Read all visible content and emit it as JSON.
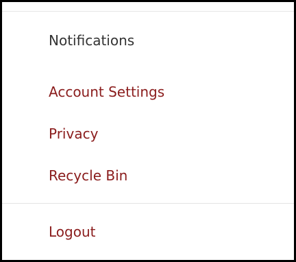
{
  "menu": {
    "header_label": "Notifications",
    "items": [
      {
        "label": "Account Settings"
      },
      {
        "label": "Privacy"
      },
      {
        "label": "Recycle Bin"
      }
    ],
    "logout_label": "Logout"
  },
  "colors": {
    "header_text": "#333333",
    "link_text": "#8a1c1c",
    "divider": "#e3e3e3",
    "border": "#000000"
  }
}
